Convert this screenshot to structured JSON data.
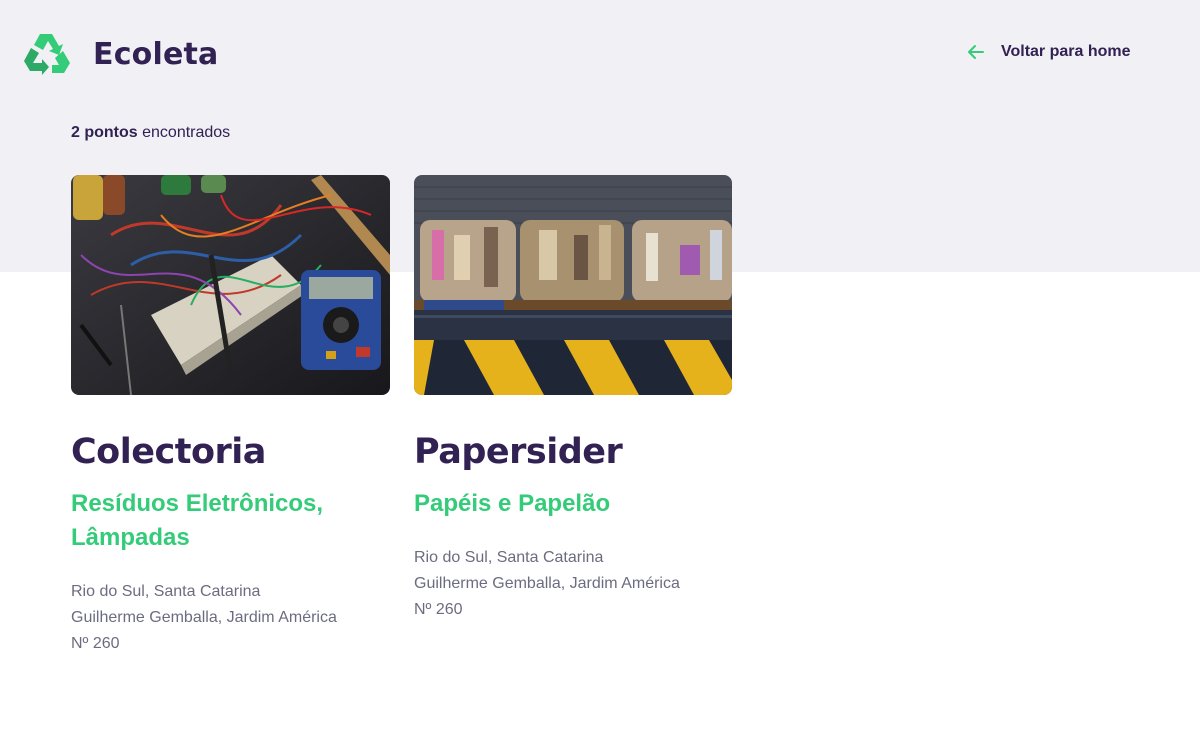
{
  "header": {
    "app_name": "Ecoleta",
    "logo_icon": "recycle-icon",
    "back_icon": "arrow-left-icon",
    "back_label": "Voltar para home"
  },
  "results": {
    "count_bold": "2 pontos",
    "count_rest": " encontrados"
  },
  "points": [
    {
      "name": "Colectoria",
      "items": "Resíduos Eletrônicos, Lâmpadas",
      "city_state": "Rio do Sul, Santa Catarina",
      "street": "Guilherme Gemballa, Jardim América",
      "number": "Nº 260",
      "image_subject": "electronics-workbench"
    },
    {
      "name": "Papersider",
      "items": "Papéis e Papelão",
      "city_state": "Rio do Sul, Santa Catarina",
      "street": "Guilherme Gemballa, Jardim América",
      "number": "Nº 260",
      "image_subject": "cardboard-bales"
    }
  ],
  "colors": {
    "background_top": "#f0f0f5",
    "title": "#322153",
    "accent_green": "#34cb79",
    "text_gray": "#6c6c80"
  }
}
